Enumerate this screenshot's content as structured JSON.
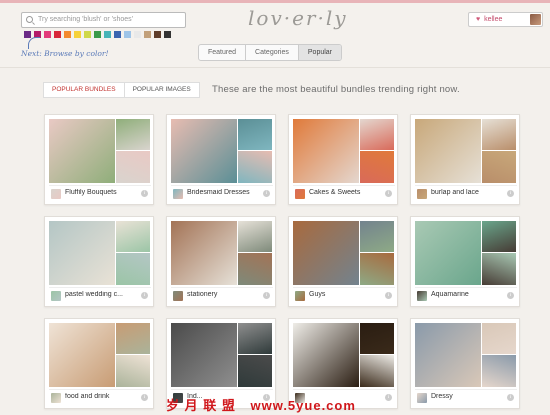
{
  "search": {
    "placeholder": "Try searching 'blush' or 'shoes'"
  },
  "swatches": [
    "#6b2a86",
    "#b31b6a",
    "#e33a7a",
    "#d8263a",
    "#f38a2f",
    "#f6d23b",
    "#cfd84a",
    "#3a9a4a",
    "#47b4b7",
    "#3a64b0",
    "#9ec4e8",
    "#e9e9e9",
    "#c2a07a",
    "#5e3d2a",
    "#333333"
  ],
  "hint": "Next: Browse by color!",
  "logo": "lov·er·ly",
  "nav": {
    "tabs": [
      "Featured",
      "Categories",
      "Popular"
    ],
    "active": "Popular"
  },
  "user": {
    "name": "kellee"
  },
  "toggle": {
    "options": [
      "POPULAR BUNDLES",
      "POPULAR IMAGES"
    ],
    "active": "POPULAR BUNDLES"
  },
  "headline": "These are the most beautiful bundles trending right now.",
  "cards": [
    {
      "title": "Fluffily Bouquets",
      "c": [
        "#e9c9c4",
        "#8fae7a",
        "#d9d4ce"
      ]
    },
    {
      "title": "Bridesmaid Dresses",
      "c": [
        "#e7bcb1",
        "#5b8f96",
        "#7fb6bf"
      ]
    },
    {
      "title": "Cakes & Sweets",
      "c": [
        "#e07a3a",
        "#e4d7cf",
        "#d96a5a"
      ]
    },
    {
      "title": "burlap and lace",
      "c": [
        "#c8a87a",
        "#e6e0d6",
        "#b98e6a"
      ]
    },
    {
      "title": "pastel wedding c...",
      "c": [
        "#b4c6c5",
        "#e9e2d6",
        "#9bc5a6"
      ]
    },
    {
      "title": "stationery",
      "c": [
        "#a37356",
        "#e6e1d8",
        "#7e8a7a"
      ]
    },
    {
      "title": "Guys",
      "c": [
        "#a86a3e",
        "#73838e",
        "#8eaa86"
      ]
    },
    {
      "title": "Aquamarine",
      "c": [
        "#a9c9b4",
        "#6aa68c",
        "#463b34"
      ]
    },
    {
      "title": "food and drink",
      "c": [
        "#efe3d6",
        "#c89c74",
        "#aab39a"
      ]
    },
    {
      "title": "Ind...",
      "c": [
        "#4b4b4b",
        "#8f8f8f",
        "#2f3a3a"
      ]
    },
    {
      "title": "",
      "c": [
        "#efede8",
        "#2a1d12",
        "#3a2a1a"
      ]
    },
    {
      "title": "Dressy",
      "c": [
        "#8a9aaa",
        "#d9c8b8",
        "#e6d7cc"
      ]
    }
  ],
  "watermark": {
    "text": "岁 月 联 盟",
    "url": "www.5yue.com"
  }
}
